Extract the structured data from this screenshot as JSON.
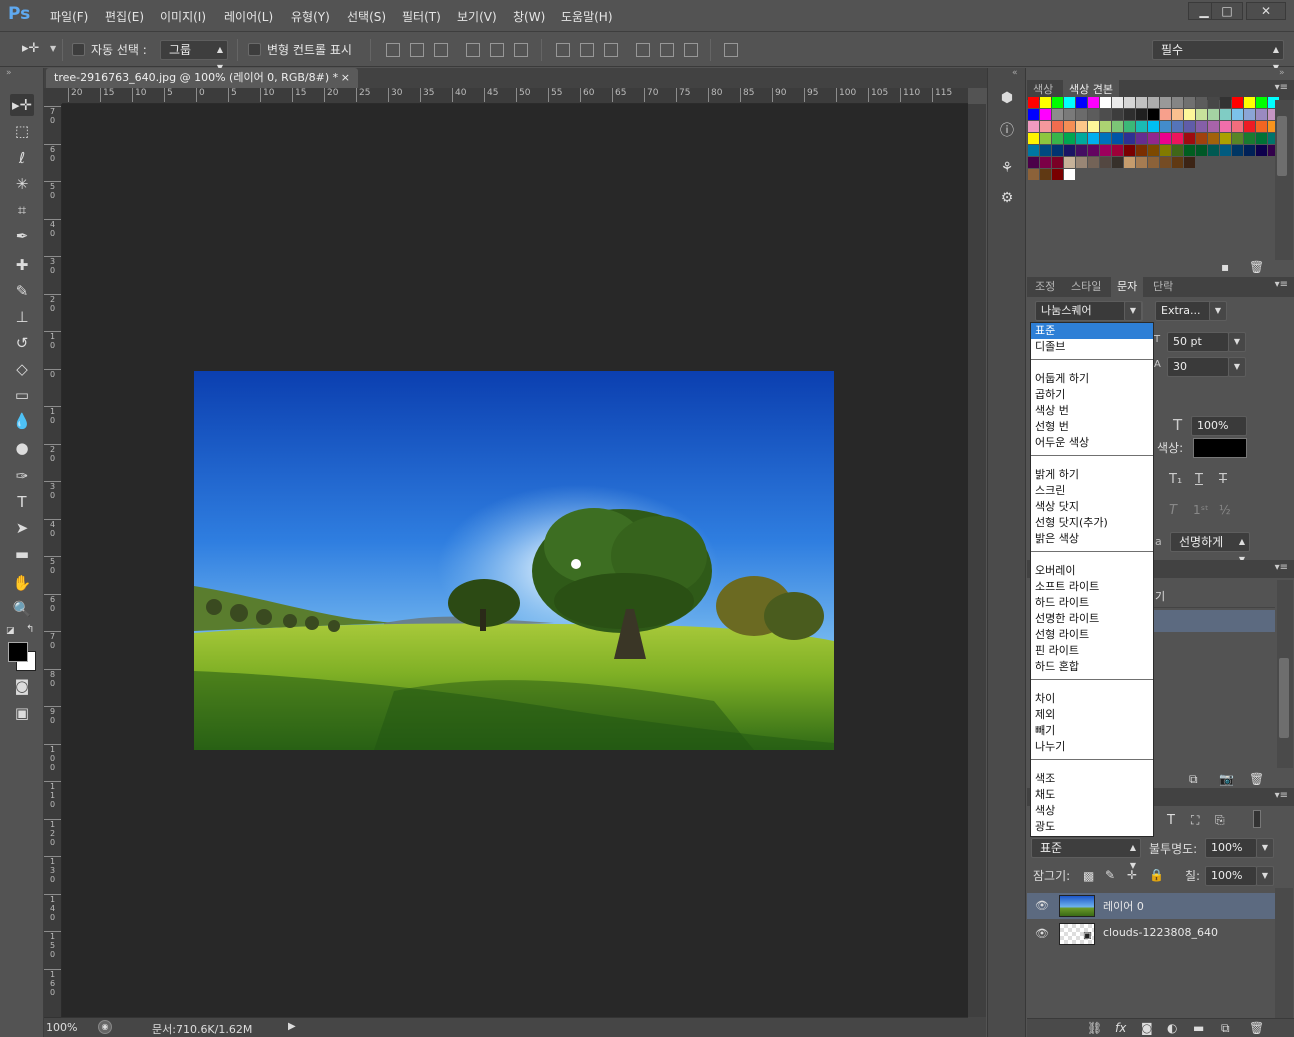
{
  "app": {
    "logo": "Ps"
  },
  "menu": [
    "파일(F)",
    "편집(E)",
    "이미지(I)",
    "레이어(L)",
    "유형(Y)",
    "선택(S)",
    "필터(T)",
    "보기(V)",
    "창(W)",
    "도움말(H)"
  ],
  "window_controls": {
    "minimize": "▁",
    "maximize": "□",
    "close": "✕"
  },
  "options": {
    "auto_select_label": "자동 선택 :",
    "auto_select_value": "그룹",
    "transform_label": "변형 컨트롤 표시",
    "workspace": "필수"
  },
  "document": {
    "tab_title": "tree-2916763_640.jpg @ 100% (레이어 0, RGB/8#) *",
    "tab_close": "×",
    "hruler": [
      "20",
      "15",
      "10",
      "5",
      "0",
      "5",
      "10",
      "15",
      "20",
      "25",
      "30",
      "35",
      "40",
      "45",
      "50",
      "55",
      "60",
      "65",
      "70",
      "75",
      "80",
      "85",
      "90",
      "95",
      "100",
      "105",
      "110",
      "115"
    ],
    "vruler": [
      "7\n0",
      "6\n0",
      "5\n0",
      "4\n0",
      "3\n0",
      "2\n0",
      "1\n0",
      "0",
      "1\n0",
      "2\n0",
      "3\n0",
      "4\n0",
      "5\n0",
      "6\n0",
      "7\n0",
      "8\n0",
      "9\n0",
      "1\n0\n0",
      "1\n1\n0",
      "1\n2\n0",
      "1\n3\n0",
      "1\n4\n0",
      "1\n5\n0",
      "1\n6\n0"
    ]
  },
  "status": {
    "zoom": "100%",
    "doc_size": "문서:710.6K/1.62M"
  },
  "swatches_panel": {
    "tabs": [
      "색상",
      "색상 견본"
    ]
  },
  "character_panel": {
    "tabs": [
      "조정",
      "스타일",
      "문자",
      "단락"
    ],
    "font_family": "나눔스퀘어",
    "font_style": "Extra...",
    "size": "50 pt",
    "leading": "30",
    "scale": "100%",
    "color_label": "색상:",
    "aa": "선명하게",
    "aa_prefix": "a"
  },
  "blend_menu": {
    "groups": [
      [
        "표준",
        "디졸브"
      ],
      [
        "어둡게 하기",
        "곱하기",
        "색상 번",
        "선형 번",
        "어두운 색상"
      ],
      [
        "밝게 하기",
        "스크린",
        "색상 닷지",
        "선형 닷지(추가)",
        "밝은 색상"
      ],
      [
        "오버레이",
        "소프트 라이트",
        "하드 라이트",
        "선명한 라이트",
        "선형 라이트",
        "핀 라이트",
        "하드 혼합"
      ],
      [
        "차이",
        "제외",
        "빼기",
        "나누기"
      ],
      [
        "색조",
        "채도",
        "색상",
        "광도"
      ]
    ],
    "selected": "표준"
  },
  "layers_panel": {
    "partial_label": "기",
    "blend_mode": "표준",
    "opacity_label": "불투명도:",
    "opacity": "100%",
    "lock_label": "잠그기:",
    "fill_label": "칠:",
    "fill": "100%",
    "layers": [
      {
        "name": "레이어 0",
        "selected": true
      },
      {
        "name": "clouds-1223808_640",
        "selected": false
      }
    ]
  }
}
